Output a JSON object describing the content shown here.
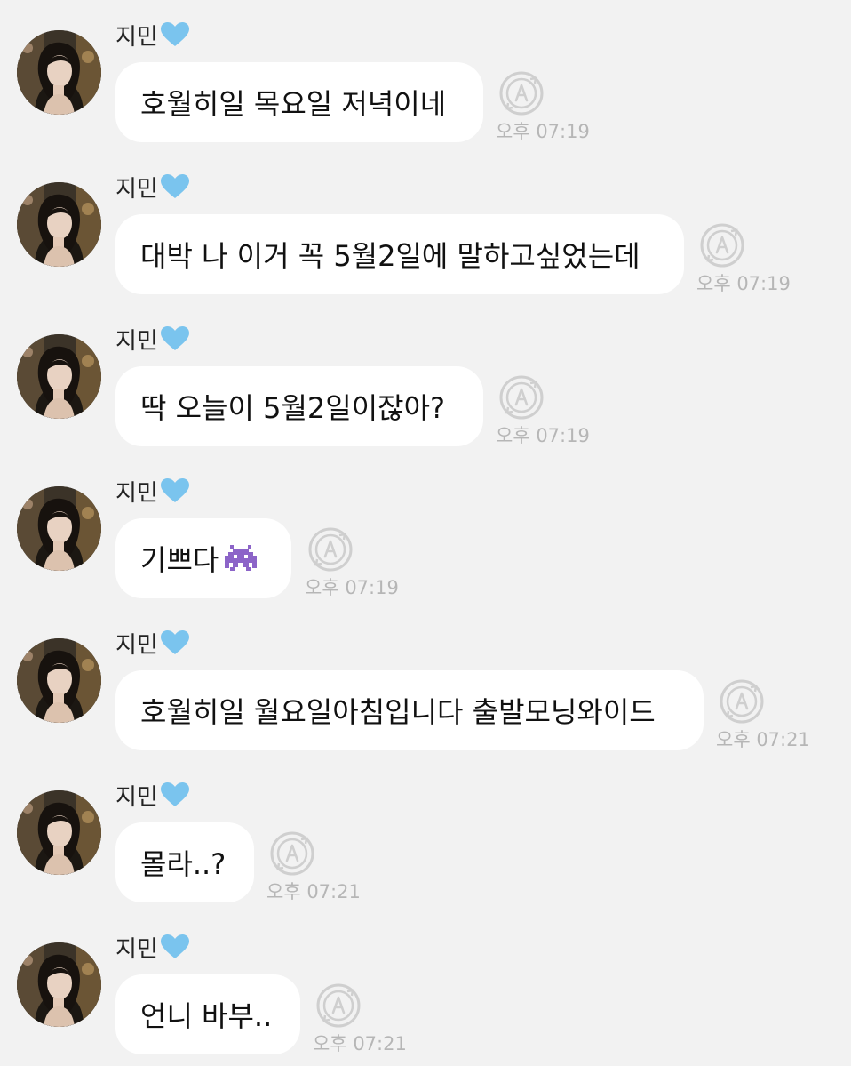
{
  "sender": {
    "name": "지민",
    "badge_icon": "light-blue-heart-icon",
    "badge_color": "#7ac4ee",
    "avatar_icon": "profile-photo-avatar"
  },
  "messages": [
    {
      "text": "호월히일 목요일 저녁이네",
      "time": "오후 07:19"
    },
    {
      "text": "대박 나 이거 꼭 5월2일에 말하고싶었는데",
      "time": "오후 07:19"
    },
    {
      "text": "딱 오늘이 5월2일이잖아?",
      "time": "오후 07:19"
    },
    {
      "text": "기쁘다",
      "emoji": "alien-monster-emoji",
      "time": "오후 07:19"
    },
    {
      "text": "호월히일 월요일아침입니다 출발모닝와이드",
      "time": "오후 07:21"
    },
    {
      "text": "몰라..?",
      "time": "오후 07:21"
    },
    {
      "text": "언니 바부..",
      "time": "오후 07:21"
    }
  ],
  "icons": {
    "translate": "translate-a-icon",
    "translate_color": "#cfcfcf"
  },
  "colors": {
    "background": "#f2f2f2",
    "bubble": "#ffffff",
    "time_text": "#b6b6b6",
    "emoji_purple": "#8c64c8"
  }
}
